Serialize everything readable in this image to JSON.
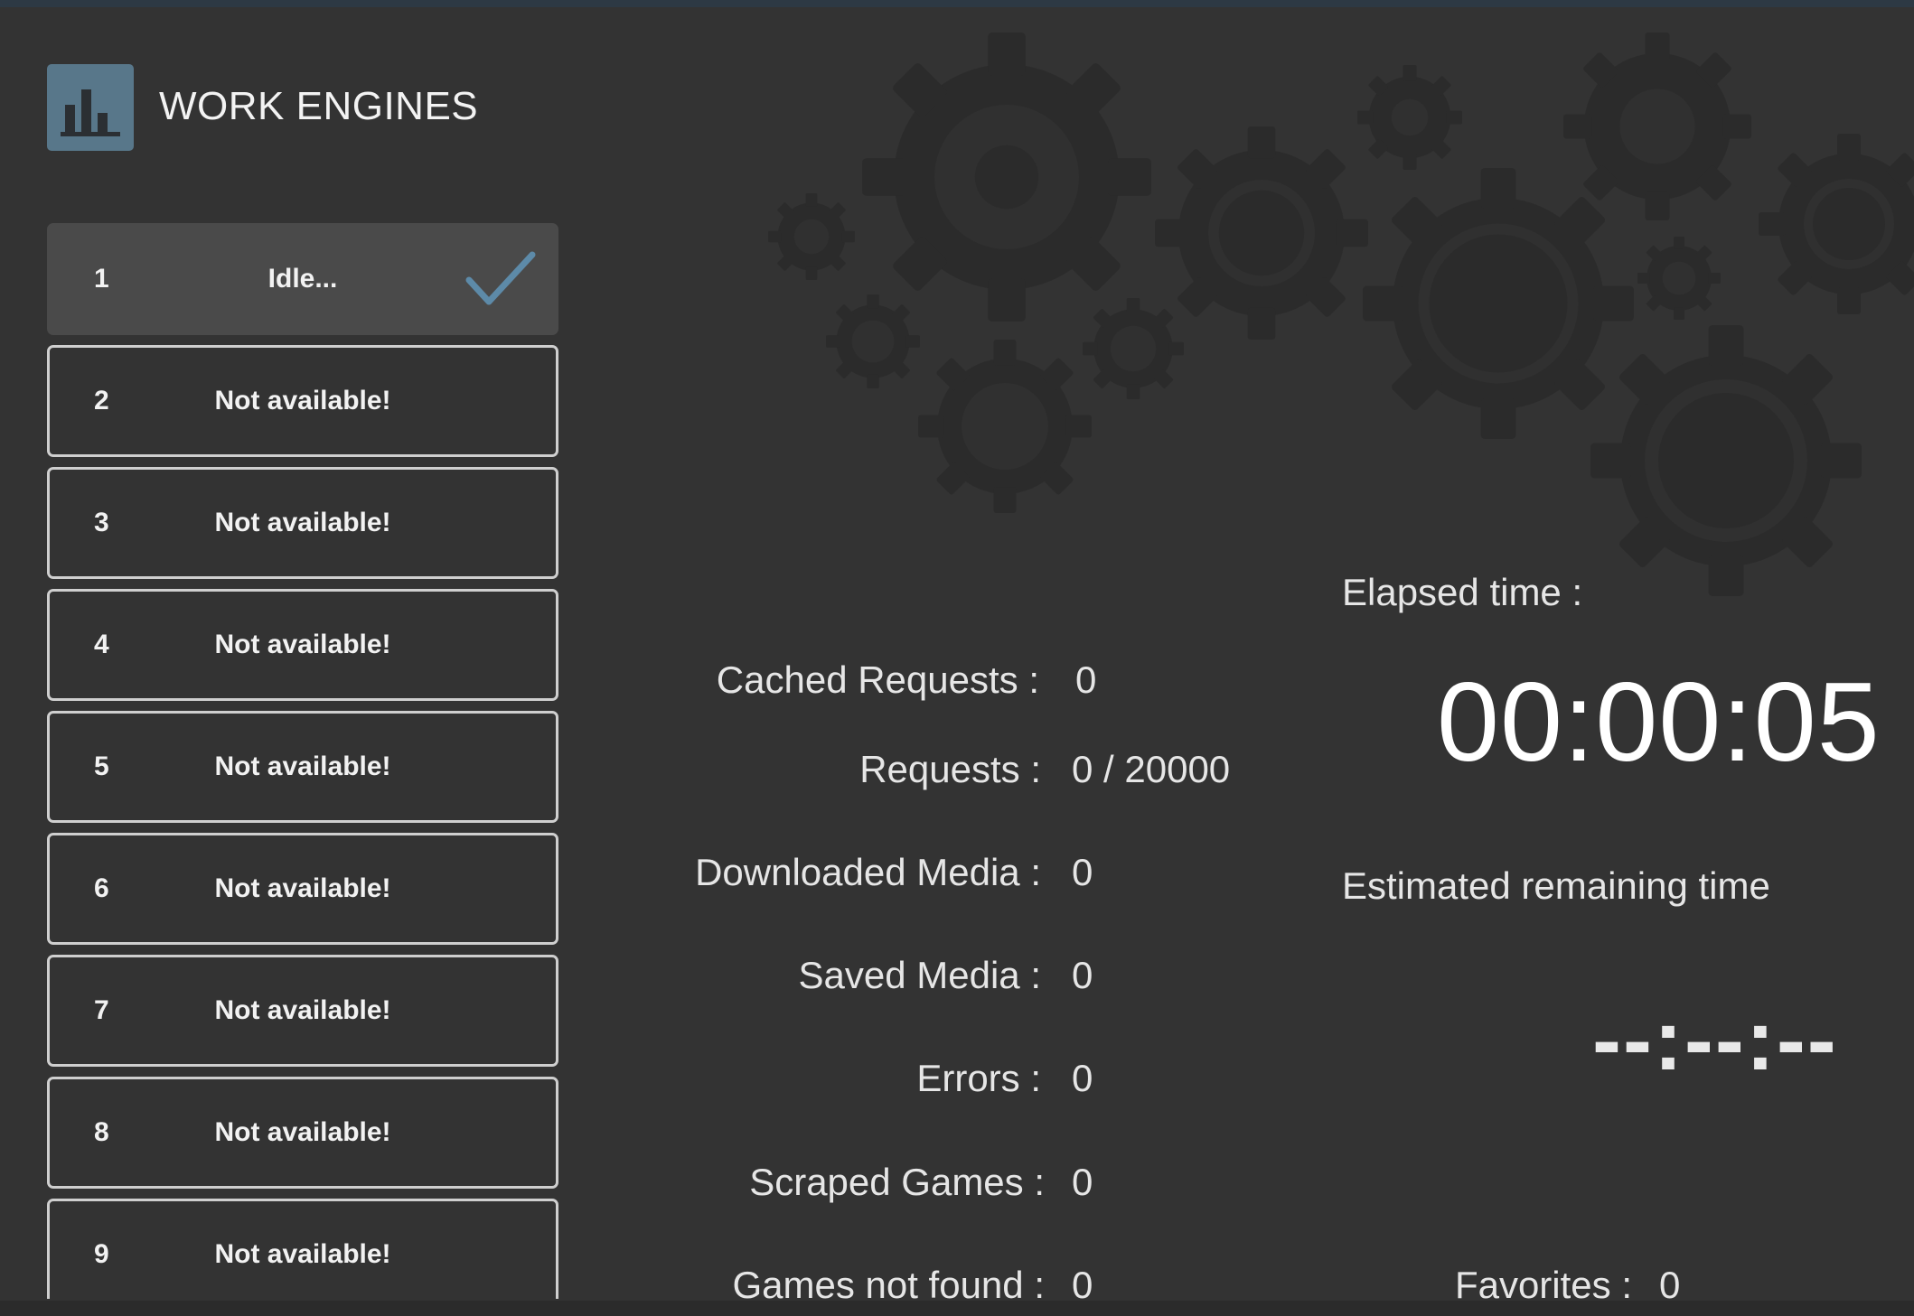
{
  "header": {
    "title": "WORK ENGINES",
    "logo_icon": "bar-chart-icon"
  },
  "engines": [
    {
      "number": "1",
      "status": "Idle...",
      "active": true,
      "icon": "checkmark-icon"
    },
    {
      "number": "2",
      "status": "Not available!"
    },
    {
      "number": "3",
      "status": "Not available!"
    },
    {
      "number": "4",
      "status": "Not available!"
    },
    {
      "number": "5",
      "status": "Not available!"
    },
    {
      "number": "6",
      "status": "Not available!"
    },
    {
      "number": "7",
      "status": "Not available!"
    },
    {
      "number": "8",
      "status": "Not available!"
    },
    {
      "number": "9",
      "status": "Not available!"
    }
  ],
  "stats": {
    "cached_requests": {
      "label": "Cached Requests :",
      "value": "0"
    },
    "requests": {
      "label": "Requests :",
      "value": "0 / 20000"
    },
    "downloaded_media": {
      "label": "Downloaded Media :",
      "value": "0"
    },
    "saved_media": {
      "label": "Saved Media :",
      "value": "0"
    },
    "errors": {
      "label": "Errors :",
      "value": "0"
    },
    "scraped_games": {
      "label": "Scraped Games :",
      "value": "0"
    },
    "games_not_found": {
      "label": "Games not found :",
      "value": "0"
    },
    "favorites": {
      "label": "Favorites :",
      "value": "0"
    }
  },
  "timing": {
    "elapsed_label": "Elapsed time :",
    "elapsed_value": "00:00:05",
    "remaining_label": "Estimated remaining time",
    "remaining_value": "--:--:--"
  },
  "colors": {
    "background": "#333333",
    "accent": "#58778a",
    "check": "#5d8aa8",
    "text": "#e6e6e6"
  },
  "background_icon": "gears-icon"
}
